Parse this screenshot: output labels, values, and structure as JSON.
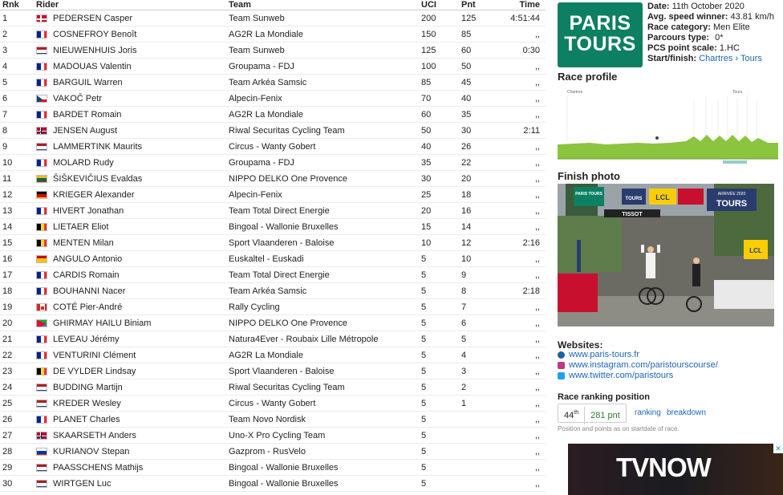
{
  "table": {
    "headers": {
      "rnk": "Rnk",
      "rider": "Rider",
      "team": "Team",
      "uci": "UCI",
      "pnt": "Pnt",
      "time": "Time"
    },
    "rows": [
      {
        "rnk": "1",
        "flag": "DK",
        "rider": "PEDERSEN Casper",
        "team": "Team Sunweb",
        "uci": "200",
        "pnt": "125",
        "time": "4:51:44"
      },
      {
        "rnk": "2",
        "flag": "FR",
        "rider": "COSNEFROY Benoît",
        "team": "AG2R La Mondiale",
        "uci": "150",
        "pnt": "85",
        "time": ",,"
      },
      {
        "rnk": "3",
        "flag": "NL",
        "rider": "NIEUWENHUIS Joris",
        "team": "Team Sunweb",
        "uci": "125",
        "pnt": "60",
        "time": "0:30"
      },
      {
        "rnk": "4",
        "flag": "FR",
        "rider": "MADOUAS Valentin",
        "team": "Groupama - FDJ",
        "uci": "100",
        "pnt": "50",
        "time": ",,"
      },
      {
        "rnk": "5",
        "flag": "FR",
        "rider": "BARGUIL Warren",
        "team": "Team Arkéa Samsic",
        "uci": "85",
        "pnt": "45",
        "time": ",,"
      },
      {
        "rnk": "6",
        "flag": "CZ",
        "rider": "VAKOČ Petr",
        "team": "Alpecin-Fenix",
        "uci": "70",
        "pnt": "40",
        "time": ",,"
      },
      {
        "rnk": "7",
        "flag": "FR",
        "rider": "BARDET Romain",
        "team": "AG2R La Mondiale",
        "uci": "60",
        "pnt": "35",
        "time": ",,"
      },
      {
        "rnk": "8",
        "flag": "NO",
        "rider": "JENSEN August",
        "team": "Riwal Securitas Cycling Team",
        "uci": "50",
        "pnt": "30",
        "time": "2:11"
      },
      {
        "rnk": "9",
        "flag": "NL",
        "rider": "LAMMERTINK Maurits",
        "team": "Circus - Wanty Gobert",
        "uci": "40",
        "pnt": "26",
        "time": ",,"
      },
      {
        "rnk": "10",
        "flag": "FR",
        "rider": "MOLARD Rudy",
        "team": "Groupama - FDJ",
        "uci": "35",
        "pnt": "22",
        "time": ",,"
      },
      {
        "rnk": "11",
        "flag": "LT",
        "rider": "ŠIŠKEVIČIUS Evaldas",
        "team": "NIPPO DELKO One Provence",
        "uci": "30",
        "pnt": "20",
        "time": ",,"
      },
      {
        "rnk": "12",
        "flag": "DE",
        "rider": "KRIEGER Alexander",
        "team": "Alpecin-Fenix",
        "uci": "25",
        "pnt": "18",
        "time": ",,"
      },
      {
        "rnk": "13",
        "flag": "FR",
        "rider": "HIVERT Jonathan",
        "team": "Team Total Direct Energie",
        "uci": "20",
        "pnt": "16",
        "time": ",,"
      },
      {
        "rnk": "14",
        "flag": "BE",
        "rider": "LIETAER Eliot",
        "team": "Bingoal - Wallonie Bruxelles",
        "uci": "15",
        "pnt": "14",
        "time": ",,"
      },
      {
        "rnk": "15",
        "flag": "BE",
        "rider": "MENTEN Milan",
        "team": "Sport Vlaanderen - Baloise",
        "uci": "10",
        "pnt": "12",
        "time": "2:16"
      },
      {
        "rnk": "16",
        "flag": "ES",
        "rider": "ANGULO Antonio",
        "team": "Euskaltel - Euskadi",
        "uci": "5",
        "pnt": "10",
        "time": ",,"
      },
      {
        "rnk": "17",
        "flag": "FR",
        "rider": "CARDIS Romain",
        "team": "Team Total Direct Energie",
        "uci": "5",
        "pnt": "9",
        "time": ",,"
      },
      {
        "rnk": "18",
        "flag": "FR",
        "rider": "BOUHANNI Nacer",
        "team": "Team Arkéa Samsic",
        "uci": "5",
        "pnt": "8",
        "time": "2:18"
      },
      {
        "rnk": "19",
        "flag": "CA",
        "rider": "COTÉ Pier-André",
        "team": "Rally Cycling",
        "uci": "5",
        "pnt": "7",
        "time": ",,"
      },
      {
        "rnk": "20",
        "flag": "ER",
        "rider": "GHIRMAY HAILU Biniam",
        "team": "NIPPO DELKO One Provence",
        "uci": "5",
        "pnt": "6",
        "time": ",,"
      },
      {
        "rnk": "21",
        "flag": "FR",
        "rider": "LEVEAU Jérémy",
        "team": "Natura4Ever - Roubaix Lille Métropole",
        "uci": "5",
        "pnt": "5",
        "time": ",,"
      },
      {
        "rnk": "22",
        "flag": "FR",
        "rider": "VENTURINI Clément",
        "team": "AG2R La Mondiale",
        "uci": "5",
        "pnt": "4",
        "time": ",,"
      },
      {
        "rnk": "23",
        "flag": "BE",
        "rider": "DE VYLDER Lindsay",
        "team": "Sport Vlaanderen - Baloise",
        "uci": "5",
        "pnt": "3",
        "time": ",,"
      },
      {
        "rnk": "24",
        "flag": "NL",
        "rider": "BUDDING Martijn",
        "team": "Riwal Securitas Cycling Team",
        "uci": "5",
        "pnt": "2",
        "time": ",,"
      },
      {
        "rnk": "25",
        "flag": "NL",
        "rider": "KREDER Wesley",
        "team": "Circus - Wanty Gobert",
        "uci": "5",
        "pnt": "1",
        "time": ",,"
      },
      {
        "rnk": "26",
        "flag": "FR",
        "rider": "PLANET Charles",
        "team": "Team Novo Nordisk",
        "uci": "5",
        "pnt": "",
        "time": ",,"
      },
      {
        "rnk": "27",
        "flag": "NO",
        "rider": "SKAARSETH Anders",
        "team": "Uno-X Pro Cycling Team",
        "uci": "5",
        "pnt": "",
        "time": ",,"
      },
      {
        "rnk": "28",
        "flag": "RU",
        "rider": "KURIANOV Stepan",
        "team": "Gazprom - RusVelo",
        "uci": "5",
        "pnt": "",
        "time": ",,"
      },
      {
        "rnk": "29",
        "flag": "NL",
        "rider": "PAASSCHENS Mathijs",
        "team": "Bingoal - Wallonie Bruxelles",
        "uci": "5",
        "pnt": "",
        "time": ",,"
      },
      {
        "rnk": "30",
        "flag": "NL",
        "rider": "WIRTGEN Luc",
        "team": "Bingoal - Wallonie Bruxelles",
        "uci": "5",
        "pnt": "",
        "time": ",,"
      }
    ]
  },
  "flags": {
    "DK": {
      "type": "nordic",
      "bg": "#c8102e",
      "cross": "#ffffff"
    },
    "NO": {
      "type": "nordic",
      "bg": "#ba0c2f",
      "cross": "#ffffff",
      "inner": "#00205b"
    },
    "FR": {
      "type": "v",
      "colors": [
        "#002395",
        "#ffffff",
        "#ed2939"
      ]
    },
    "BE": {
      "type": "v",
      "colors": [
        "#000000",
        "#fdda24",
        "#ef3340"
      ]
    },
    "NL": {
      "type": "h",
      "colors": [
        "#ae1c28",
        "#ffffff",
        "#21468b"
      ]
    },
    "DE": {
      "type": "h",
      "colors": [
        "#000000",
        "#dd0000",
        "#ffce00"
      ]
    },
    "LT": {
      "type": "h",
      "colors": [
        "#fdb913",
        "#006a44",
        "#c1272d"
      ]
    },
    "RU": {
      "type": "h",
      "colors": [
        "#ffffff",
        "#0039a6",
        "#d52b1e"
      ]
    },
    "ES": {
      "type": "es",
      "colors": [
        "#c60b1e",
        "#ffc400",
        "#c60b1e"
      ]
    },
    "CA": {
      "type": "ca",
      "colors": [
        "#d52b1e",
        "#ffffff",
        "#d52b1e"
      ]
    },
    "CZ": {
      "type": "cz",
      "colors": [
        "#ffffff",
        "#d7141a",
        "#11457e"
      ]
    },
    "ER": {
      "type": "er",
      "colors": [
        "#12ad2b",
        "#4189dd",
        "#ea0437"
      ]
    }
  },
  "race": {
    "logo_line1": "PARIS",
    "logo_line2": "TOURS",
    "date_label": "Date:",
    "date_value": "11th October 2020",
    "speed_label": "Avg. speed winner:",
    "speed_value": "43.81 km/h",
    "category_label": "Race category:",
    "category_value": "Men Elite",
    "parcours_label": "Parcours type:",
    "parcours_value": "0*",
    "points_label": "PCS point scale:",
    "points_value": "1.HC",
    "startfinish_label": "Start/finish:",
    "start_city": "Chartres",
    "arrow": "›",
    "finish_city": "Tours"
  },
  "profile": {
    "title": "Race profile",
    "start_label": "Chartres",
    "finish_label": "Tours"
  },
  "photo": {
    "title": "Finish photo",
    "banner_left": "PARIS TOURS",
    "banner_mid": "TOURS",
    "banner_lcl": "LCL",
    "banner_right": "ARRIVÉE 2020",
    "banner_right2": "TOURS",
    "tissot": "TISSOT",
    "lcl_side": "LCL"
  },
  "websites": {
    "title": "Websites:",
    "links": [
      {
        "text": "www.paris-tours.fr",
        "icon": "globe-icon",
        "color": "#1e5fa8"
      },
      {
        "text": "www.instagram.com/paristourscourse/",
        "icon": "instagram-icon",
        "color": "#c13584"
      },
      {
        "text": "www.twitter.com/paristours",
        "icon": "twitter-icon",
        "color": "#1da1f2"
      }
    ]
  },
  "ranking": {
    "title": "Race ranking position",
    "position": "44",
    "position_suffix": "th",
    "points": "281 pnt",
    "link_ranking": "ranking",
    "link_breakdown": "breakdown",
    "note": "Position and points as on startdate of race."
  },
  "ad": {
    "brand": "TVNOW",
    "close": "✕"
  }
}
